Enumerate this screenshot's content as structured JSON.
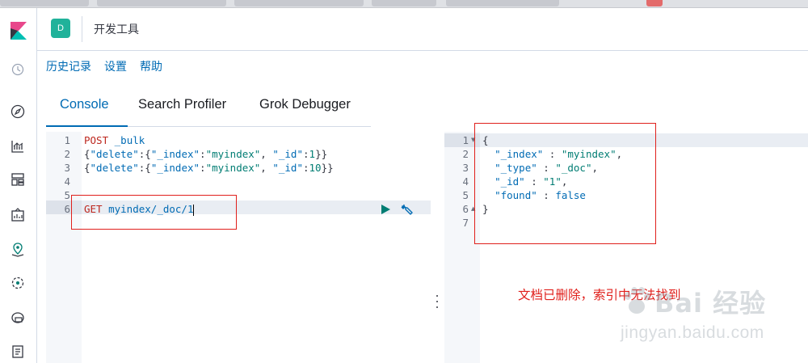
{
  "header": {
    "space_initial": "D",
    "title": "开发工具"
  },
  "toplinks": {
    "history": "历史记录",
    "settings": "设置",
    "help": "帮助"
  },
  "tabs": [
    {
      "label": "Console",
      "active": true
    },
    {
      "label": "Search Profiler",
      "active": false
    },
    {
      "label": "Grok Debugger",
      "active": false
    }
  ],
  "editor": {
    "line_numbers": [
      "1",
      "2",
      "3",
      "4",
      "5",
      "6"
    ],
    "request1_method": "POST",
    "request1_path": "_bulk",
    "delete1": {
      "key_delete": "\"delete\"",
      "key_index": "\"_index\"",
      "val_index": "\"myindex\"",
      "key_id": "\"_id\"",
      "val_id": "1"
    },
    "delete2": {
      "key_delete": "\"delete\"",
      "key_index": "\"_index\"",
      "val_index": "\"myindex\"",
      "key_id": "\"_id\"",
      "val_id": "10"
    },
    "request2_method": "GET",
    "request2_path": "myindex/_doc/1"
  },
  "output": {
    "line_numbers": [
      "1",
      "2",
      "3",
      "4",
      "5",
      "6",
      "7"
    ],
    "key_index": "\"_index\"",
    "val_index": "\"myindex\"",
    "key_type": "\"_type\"",
    "val_type": "\"_doc\"",
    "key_id": "\"_id\"",
    "val_id": "\"1\"",
    "key_found": "\"found\"",
    "val_found": "false"
  },
  "annotation": {
    "text": "文档已删除，索引中无法找到",
    "color": "#e0201c"
  },
  "watermark": {
    "brand": "Bai 经验",
    "url": "jingyan.baidu.com"
  },
  "colors": {
    "accent": "#006bb4",
    "space_avatar": "#20b29a",
    "run_button": "#017d73"
  },
  "icons": {
    "rail": [
      "recent-clock-icon",
      "discover-compass-icon",
      "visualize-chart-icon",
      "dashboard-icon",
      "canvas-icon",
      "maps-icon",
      "ml-icon",
      "infra-icon",
      "logs-icon"
    ],
    "editor_actions": [
      "play-icon",
      "wrench-icon"
    ]
  }
}
